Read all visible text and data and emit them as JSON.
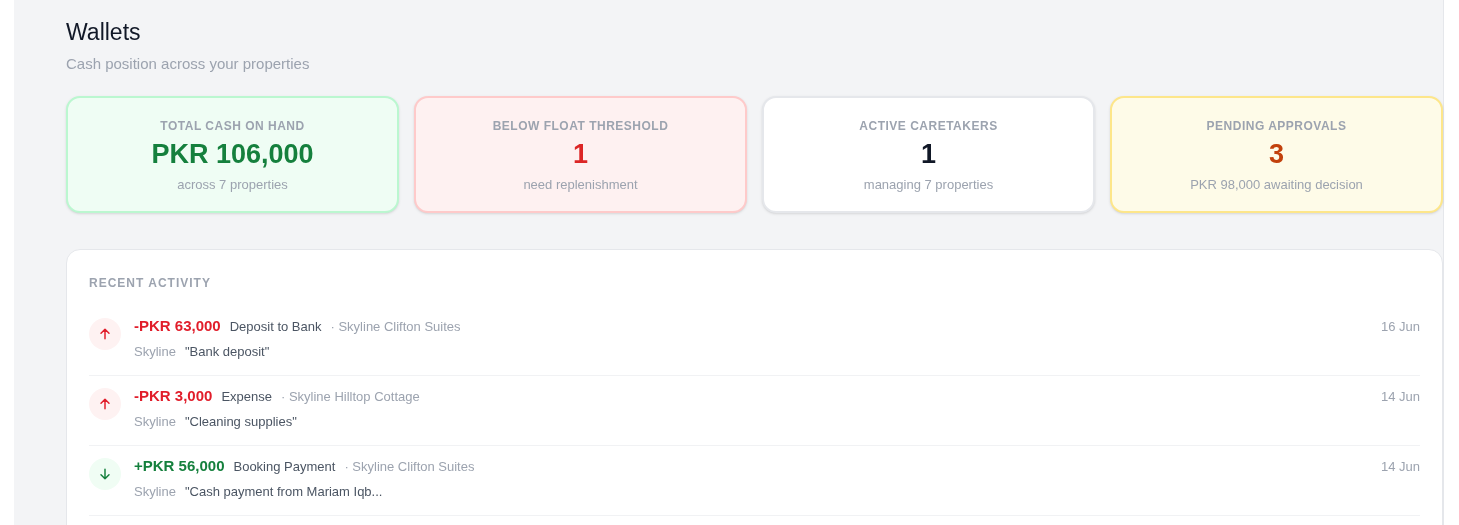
{
  "header": {
    "title": "Wallets",
    "subtitle": "Cash position across your properties"
  },
  "stats": [
    {
      "label": "TOTAL CASH ON HAND",
      "value": "PKR 106,000",
      "note": "across 7 properties",
      "kind": "success"
    },
    {
      "label": "BELOW FLOAT THRESHOLD",
      "value": "1",
      "note": "need replenishment",
      "kind": "danger"
    },
    {
      "label": "ACTIVE CARETAKERS",
      "value": "1",
      "note": "managing 7 properties",
      "kind": "neutral"
    },
    {
      "label": "PENDING APPROVALS",
      "value": "3",
      "note": "PKR 98,000 awaiting decision",
      "kind": "warning"
    }
  ],
  "recent_activity": {
    "title": "RECENT ACTIVITY",
    "items": [
      {
        "kind": "outflow",
        "amount": "-PKR 63,000",
        "type": "Deposit to Bank",
        "property": "· Skyline Clifton Suites",
        "actor": "Skyline",
        "note": "\"Bank deposit\"",
        "date": "16 Jun"
      },
      {
        "kind": "outflow",
        "amount": "-PKR 3,000",
        "type": "Expense",
        "property": "· Skyline Hilltop Cottage",
        "actor": "Skyline",
        "note": "\"Cleaning supplies\"",
        "date": "14 Jun"
      },
      {
        "kind": "inflow",
        "amount": "+PKR 56,000",
        "type": "Booking Payment",
        "property": "· Skyline Clifton Suites",
        "actor": "Skyline",
        "note": "\"Cash payment from Mariam Iqb...",
        "date": "14 Jun"
      }
    ]
  }
}
